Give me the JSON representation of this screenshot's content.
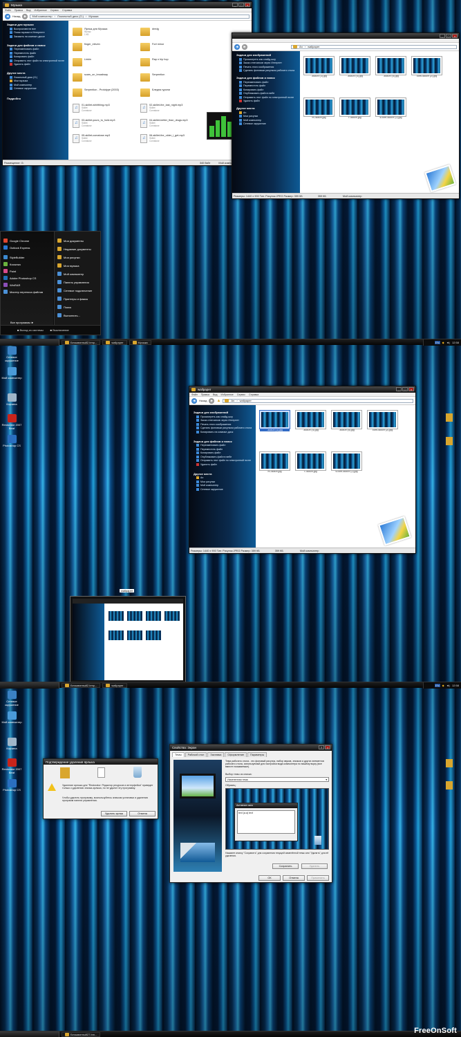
{
  "panel1": {
    "music_window": {
      "title": "Музыка",
      "menu": [
        "Файл",
        "Правка",
        "Вид",
        "Избранное",
        "Сервис",
        "Справка"
      ],
      "back": "Назад",
      "address": [
        "Мой компьютер",
        "Локальный диск (G:)",
        "Музыка"
      ],
      "tasks_title": "Задачи для музыки",
      "tasks": [
        "Воспроизвести все",
        "Поиск музыки в Интернете",
        "Заказать на компакт-диске"
      ],
      "filetasks_title": "Задачи для файлов и папок",
      "filetasks": [
        "Переименовать файл",
        "Переместить файл",
        "Копировать файл",
        "Отправить этот файл по электронной почте",
        "Удалить файл"
      ],
      "places_title": "Другие места",
      "places": [
        "Локальный диск (G:)",
        "Мои музыка",
        "Мой компьютер",
        "Сетевое окружение"
      ],
      "details_title": "Подробно",
      "files": [
        {
          "name": "Ярлык для Музыка",
          "sub": "Ярлык",
          "sub2": "1 КБ",
          "kind": "folder"
        },
        {
          "name": "dredg",
          "kind": "folder"
        },
        {
          "name": "finger_eleven",
          "kind": "folder"
        },
        {
          "name": "Fort minor",
          "kind": "folder"
        },
        {
          "name": "Linkin",
          "kind": "folder"
        },
        {
          "name": "Rap n hip hop",
          "kind": "folder"
        },
        {
          "name": "scars_on_broadway",
          "kind": "folder"
        },
        {
          "name": "Serpention",
          "kind": "folder"
        },
        {
          "name": "Serpention - Prototype (2003)",
          "kind": "folder"
        },
        {
          "name": "Бледна гурини",
          "kind": "folder"
        },
        {
          "name": "01-skillet-whirlthing.mp3",
          "sub": "Skillet",
          "sub2": "Comatose",
          "kind": "mp3"
        },
        {
          "name": "02-skillet-the_last_night.mp3",
          "sub": "Skillet",
          "sub2": "Comatose",
          "kind": "mp3"
        },
        {
          "name": "03-skillet-yours_to_hold.mp3",
          "sub": "Skillet",
          "sub2": "Comatose",
          "kind": "mp3"
        },
        {
          "name": "04-skillet-better_than_drugs.mp3",
          "sub": "Skillet",
          "sub2": "Comatose",
          "kind": "mp3"
        },
        {
          "name": "05-skillet-comatose.mp3",
          "sub": "Skillet",
          "sub2": "Comatose",
          "kind": "mp3"
        },
        {
          "name": "06-skillet-the_older_i_get.mp3",
          "sub": "Skillet",
          "sub2": "Comatose",
          "kind": "mp3"
        }
      ],
      "status": [
        "Размещение: G:",
        "",
        ""
      ],
      "status_size": "340 байт",
      "status_loc": "Мой компьютер"
    },
    "wall_window": {
      "title": "wallpaper",
      "address": [
        "An",
        "wallpaper"
      ],
      "tasks_title": "Задачи для изображений",
      "tasks": [
        "Просмотреть как слайд-шоу",
        "Заказ отпечатков через Интернет",
        "Печать этого изображения",
        "Сделать фоновым рисунком рабочего стола",
        "Копировать на компакт-диск"
      ],
      "filetasks_title": "Задачи для файлов и папок",
      "filetasks": [
        "Переименовать файл",
        "Переместить файл",
        "Копировать файл",
        "Опубликовать файл в вебе",
        "Отправить этот файл по электронной почте",
        "Удалить файл"
      ],
      "places_title": "Другие места",
      "places": [
        "An",
        "Мои рисунки",
        "Мой компьютер",
        "Сетевое окружение"
      ],
      "thumbs": [
        "-46509 (3).jpg",
        "-46509 (4).jpg",
        "-46509 (5).jpg",
        "com-46509 (2).jpg",
        "m-46509.jpg",
        "r-46509.jpg",
        "s.com-46509 (2).jpg"
      ],
      "status": "Размеры: 1440 x 900 Тип: Рисунок JPEG Размер: 359 КБ",
      "status_size": "359 КБ",
      "status_loc": "Мой компьютер"
    },
    "start_menu": {
      "left": [
        "Google Chrome",
        "Outlook Express",
        "StyleBuilder",
        "Косынка",
        "Paint",
        "Adobe Photoshop CS",
        "WinRAR",
        "Мастер переноса файлов"
      ],
      "all_programs": "Все программы",
      "right": [
        "Мои документы",
        "Недавние документы",
        "Мои рисунки",
        "Моя музыка",
        "Мой компьютер",
        "Панель управления",
        "Сетевое подключение",
        "Принтеры и факсы",
        "Поиск",
        "Выполнить..."
      ],
      "logoff": "Выход из системы",
      "shutdown": "Выключение"
    },
    "taskbar": {
      "start": "пуск",
      "items": [
        "Безымянный2.bmp...",
        "wallpaper",
        "Музыка"
      ],
      "lang": "EN",
      "time": "12:58"
    }
  },
  "panel2": {
    "desktop_icons": [
      "Сетевое окружение",
      "Мой компьютер",
      "Корзина",
      "Restorator 2007 Beat",
      "Photoshop CS"
    ],
    "window_title": "wallpaper",
    "menu": [
      "Файл",
      "Правка",
      "Вид",
      "Избранное",
      "Сервис",
      "Справка"
    ],
    "back": "Назад",
    "address": [
      "An",
      "wallpaper"
    ],
    "thumbs": [
      "-46509 (3).jpg",
      "-46509 (4).jpg",
      "-46509 (5).jpg",
      "com-46509 (2).jpg",
      "m-46509.jpg",
      "r-46509.jpg",
      "s.com-46509 (2).jpg"
    ],
    "tasks_title": "Задачи для изображений",
    "tasks": [
      "Просмотреть как слайд-шоу",
      "Заказ отпечатков через Интернет",
      "Печать этого изображения",
      "Сделать фоновым рисунком рабочего стола",
      "Копировать на компакт-диск"
    ],
    "filetasks_title": "Задачи для файлов и папок",
    "filetasks": [
      "Переименовать файл",
      "Переместить файл",
      "Копировать файл",
      "Опубликовать файл в вебе",
      "Отправить этот файл по электронной почте",
      "Удалить файл"
    ],
    "places_title": "Другие места",
    "places": [
      "An",
      "Мои рисунки",
      "Мой компьютер",
      "Сетевое окружение"
    ],
    "status": "Размеры: 1440 x 900 Тип: Рисунок JPEG Размер: 359 КБ",
    "status_size": "359 КБ",
    "status_loc": "Мой компьютер",
    "preview_label": "wallpaper",
    "taskbar": {
      "items": [
        "Безымянный2.bmp...",
        "wallpaper"
      ],
      "lang": "EN",
      "time": "12:58"
    }
  },
  "panel3": {
    "desktop_icons": [
      "Сетевое окружение",
      "Мой компьютер",
      "Корзина",
      "Restorator 2007 Beat",
      "Photoshop CS"
    ],
    "warn_dialog": {
      "title": "Подтверждение удаления ярлыка",
      "text1": "Удаление ярлыка для \"Restorator: Редактор ресурсов и интерфейса\" приведет только к удалению значка-ярлыка, но не удалит эту программу.",
      "text2": "Чтобы удалить программу, воспользуйтесь значком установки и удаления программ панели управления.",
      "btn_delete": "Удалить ярлык",
      "btn_cancel": "Отмена"
    },
    "display": {
      "title": "Свойства: Экран",
      "tabs": [
        "Темы",
        "Рабочий стол",
        "Заставка",
        "Оформление",
        "Параметры"
      ],
      "desc": "Тема рабочего стола - это фоновый рисунок, набор звуков, значков и других элементов рабочего стола, используемый для настройки вида компьютера по вашему вкусу (все вместе называемые).",
      "theme_label": "Выбор темы из списка:",
      "theme_value": "Измененная тема",
      "sample_label": "Образец:",
      "inner_window_title": "Активное окно",
      "inner_window_text": "text (a.a) text",
      "hint": "Нажмите кнопку \"Сохранить\" для сохранения текущей изменённой темы или \"Удалить\" для её удаления.",
      "save": "Сохранить",
      "delete": "Удалить",
      "ok": "ОК",
      "cancel": "Отмена",
      "apply": "Применить"
    },
    "taskbar": {
      "items": [
        "Безымянный2.bmp...",
        "wallpaper"
      ],
      "lang": "EN",
      "time": "12:57"
    }
  },
  "panel4": {
    "taskbar": {
      "items": [
        "Безымянный27.bm..."
      ]
    }
  },
  "watermark": "FreeOnSoft"
}
